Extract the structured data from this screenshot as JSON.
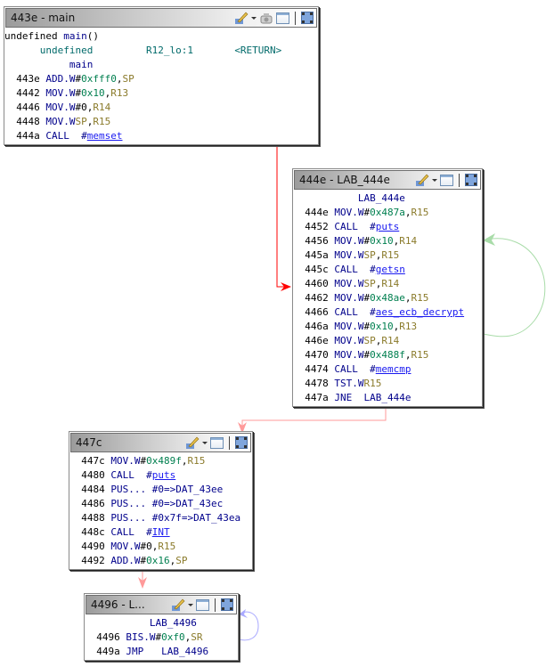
{
  "colors": {
    "edge_unconditional": "#ff0000",
    "edge_fallthrough": "#ff9a9a",
    "edge_loop_true": "#a9dca9",
    "edge_loop_self": "#a9a9ff"
  },
  "header_icons": {
    "edit": "pencil-edit-icon",
    "dropdown": "dropdown-arrow-icon",
    "snapshot": "camera-snapshot-icon",
    "window": "window-icon",
    "fullscreen": "fullscreen-icon"
  },
  "blocks": {
    "main": {
      "title": "443e - main",
      "signature": {
        "ret_type": "undefined",
        "name": "main",
        "parens": "()"
      },
      "storage": {
        "type": "undefined",
        "location": "R12_lo:1",
        "name": "<RETURN>"
      },
      "label": "main",
      "lines": [
        {
          "addr": "443e",
          "mnemonic": "ADD.W",
          "op1": "#0xfff0",
          "sep": ",",
          "op2": "SP"
        },
        {
          "addr": "4442",
          "mnemonic": "MOV.W",
          "op1": "#0x10",
          "sep": ",",
          "op2": "R13"
        },
        {
          "addr": "4446",
          "mnemonic": "MOV.W",
          "op1": "#0",
          "sep": ",",
          "op2": "R14"
        },
        {
          "addr": "4448",
          "mnemonic": "MOV.W",
          "op1": "SP",
          "sep": ",",
          "op2": "R15"
        },
        {
          "addr": "444a",
          "mnemonic": "CALL",
          "op1": "#",
          "call": "memset"
        }
      ]
    },
    "lab444e": {
      "title": "444e - LAB_444e",
      "label": "LAB_444e",
      "lines": [
        {
          "addr": "444e",
          "mnemonic": "MOV.W",
          "op1": "#0x487a",
          "op2": "R15"
        },
        {
          "addr": "4452",
          "mnemonic": "CALL",
          "call": "puts"
        },
        {
          "addr": "4456",
          "mnemonic": "MOV.W",
          "op1": "#0x10",
          "op2": "R14"
        },
        {
          "addr": "445a",
          "mnemonic": "MOV.W",
          "op1": "SP",
          "op2": "R15"
        },
        {
          "addr": "445c",
          "mnemonic": "CALL",
          "call": "getsn"
        },
        {
          "addr": "4460",
          "mnemonic": "MOV.W",
          "op1": "SP",
          "op2": "R14"
        },
        {
          "addr": "4462",
          "mnemonic": "MOV.W",
          "op1": "#0x48ae",
          "op2": "R15"
        },
        {
          "addr": "4466",
          "mnemonic": "CALL",
          "call": "aes_ecb_decrypt"
        },
        {
          "addr": "446a",
          "mnemonic": "MOV.W",
          "op1": "#0x10",
          "op2": "R13"
        },
        {
          "addr": "446e",
          "mnemonic": "MOV.W",
          "op1": "SP",
          "op2": "R14"
        },
        {
          "addr": "4470",
          "mnemonic": "MOV.W",
          "op1": "#0x488f",
          "op2": "R15"
        },
        {
          "addr": "4474",
          "mnemonic": "CALL",
          "call": "memcmp"
        },
        {
          "addr": "4478",
          "mnemonic": "TST.W",
          "op2": "R15"
        },
        {
          "addr": "447a",
          "mnemonic": "JNE",
          "target": "LAB_444e"
        }
      ]
    },
    "b447c": {
      "title": "447c",
      "lines": [
        {
          "addr": "447c",
          "mnemonic": "MOV.W",
          "op1": "#0x489f",
          "op2": "R15"
        },
        {
          "addr": "4480",
          "mnemonic": "CALL",
          "call": "puts"
        },
        {
          "addr": "4484",
          "mnemonic": "PUS...",
          "operand": "#0=>DAT_43ee"
        },
        {
          "addr": "4486",
          "mnemonic": "PUS...",
          "operand": "#0=>DAT_43ec"
        },
        {
          "addr": "4488",
          "mnemonic": "PUS...",
          "operand": "#0x7f=>DAT_43ea"
        },
        {
          "addr": "448c",
          "mnemonic": "CALL",
          "call": "INT"
        },
        {
          "addr": "4490",
          "mnemonic": "MOV.W",
          "op1": "#0",
          "op2": "R15"
        },
        {
          "addr": "4492",
          "mnemonic": "ADD.W",
          "op1": "#0x16",
          "op2": "SP"
        }
      ]
    },
    "lab4496": {
      "title": "4496 - L...",
      "label": "LAB_4496",
      "lines": [
        {
          "addr": "4496",
          "mnemonic": "BIS.W",
          "op1": "#0xf0",
          "op2": "SR"
        },
        {
          "addr": "449a",
          "mnemonic": "JMP",
          "target": "LAB_4496"
        }
      ]
    }
  }
}
